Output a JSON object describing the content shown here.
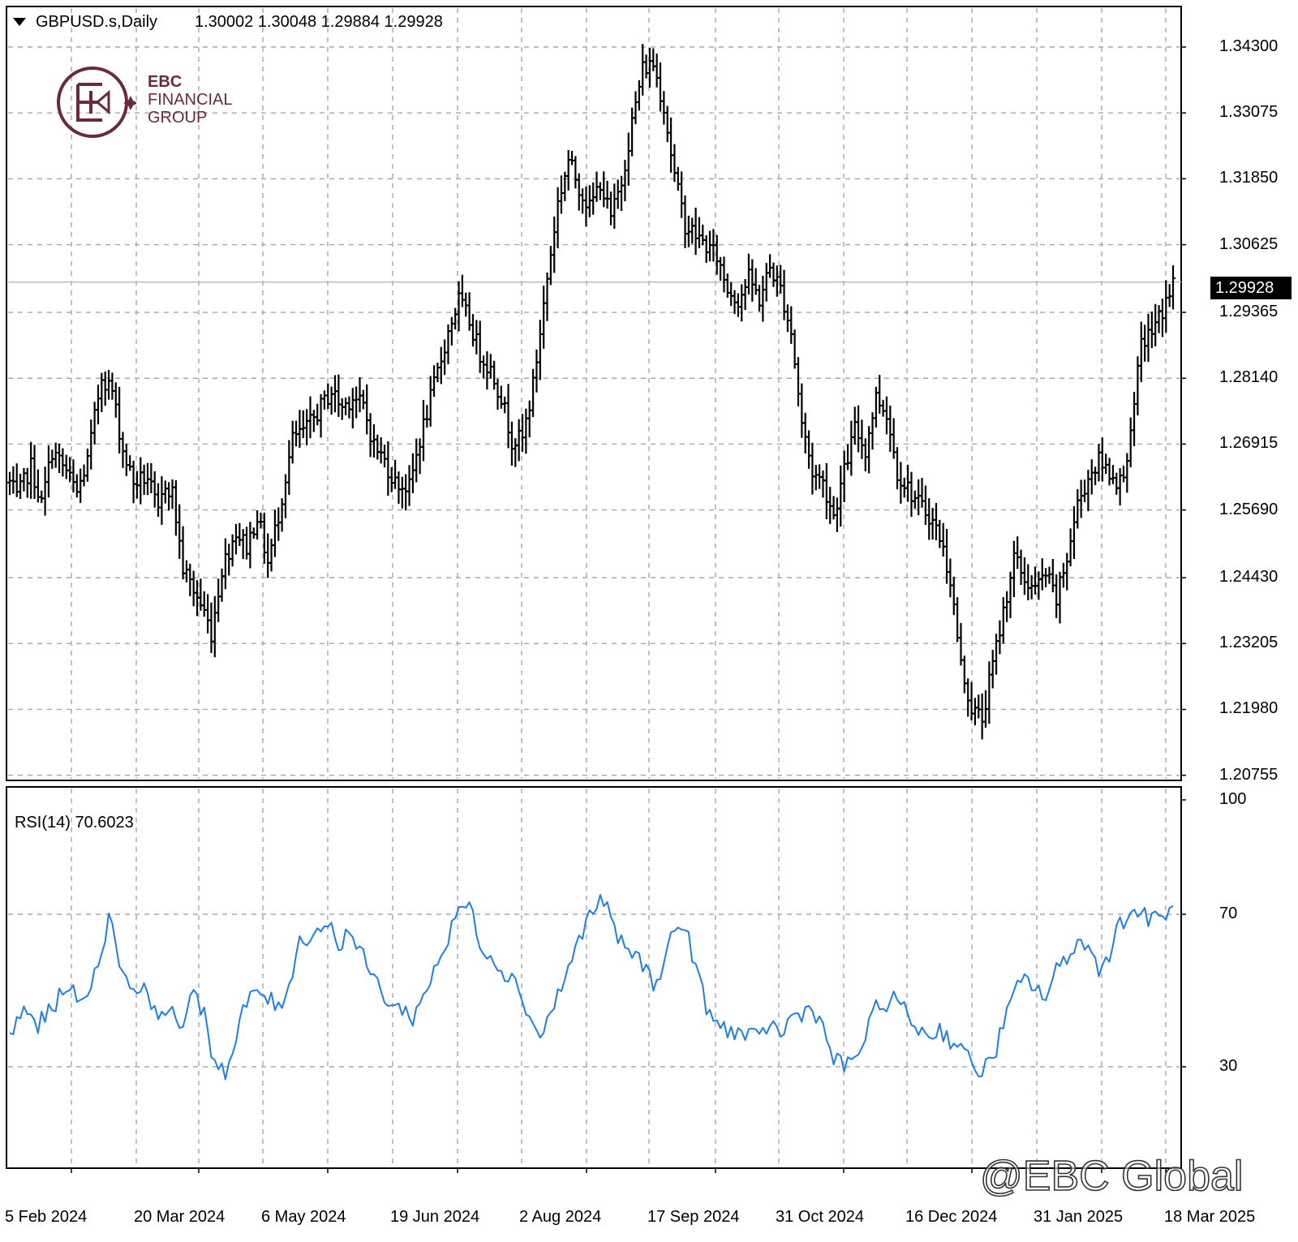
{
  "header": {
    "dropdown_icon": "triangle-down-icon",
    "symbol": "GBPUSD.s,Daily",
    "ohlc": "1.30002 1.30048 1.29884 1.29928"
  },
  "logo": {
    "line1": "EBC",
    "line2": "FINANCIAL",
    "line3": "GROUP",
    "color": "#6b2a3a"
  },
  "watermark": "@EBC Global",
  "chart_data": [
    {
      "type": "bar",
      "subtype": "ohlc",
      "title": "GBPUSD.s,Daily",
      "current_price": "1.29928",
      "y_ticks": [
        "1.34300",
        "1.33075",
        "1.31850",
        "1.30625",
        "1.29365",
        "1.28140",
        "1.26915",
        "1.25690",
        "1.24430",
        "1.23205",
        "1.21980",
        "1.20755"
      ],
      "ylim": [
        1.2075,
        1.343
      ],
      "x_ticks": [
        "5 Feb 2024",
        "20 Mar 2024",
        "6 May 2024",
        "19 Jun 2024",
        "2 Aug 2024",
        "17 Sep 2024",
        "31 Oct 2024",
        "16 Dec 2024",
        "31 Jan 2025",
        "18 Mar 2025"
      ],
      "grid": true,
      "bar_color": "#000000",
      "anchors": [
        [
          0,
          1.262
        ],
        [
          2,
          1.259
        ],
        [
          6,
          1.265
        ],
        [
          9,
          1.258
        ],
        [
          12,
          1.268
        ],
        [
          16,
          1.264
        ],
        [
          19,
          1.26
        ],
        [
          22,
          1.266
        ],
        [
          26,
          1.282
        ],
        [
          29,
          1.279
        ],
        [
          32,
          1.268
        ],
        [
          35,
          1.262
        ],
        [
          39,
          1.263
        ],
        [
          42,
          1.256
        ],
        [
          44,
          1.262
        ],
        [
          46,
          1.26
        ],
        [
          49,
          1.246
        ],
        [
          52,
          1.242
        ],
        [
          55,
          1.238
        ],
        [
          57,
          1.234
        ],
        [
          60,
          1.246
        ],
        [
          64,
          1.253
        ],
        [
          67,
          1.25
        ],
        [
          70,
          1.256
        ],
        [
          73,
          1.247
        ],
        [
          76,
          1.256
        ],
        [
          80,
          1.27
        ],
        [
          84,
          1.272
        ],
        [
          88,
          1.276
        ],
        [
          91,
          1.279
        ],
        [
          94,
          1.276
        ],
        [
          97,
          1.278
        ],
        [
          100,
          1.276
        ],
        [
          103,
          1.269
        ],
        [
          106,
          1.266
        ],
        [
          109,
          1.262
        ],
        [
          113,
          1.261
        ],
        [
          116,
          1.27
        ],
        [
          120,
          1.28
        ],
        [
          124,
          1.29
        ],
        [
          127,
          1.296
        ],
        [
          130,
          1.292
        ],
        [
          133,
          1.286
        ],
        [
          136,
          1.283
        ],
        [
          139,
          1.278
        ],
        [
          142,
          1.27
        ],
        [
          145,
          1.27
        ],
        [
          148,
          1.28
        ],
        [
          152,
          1.3
        ],
        [
          155,
          1.314
        ],
        [
          158,
          1.322
        ],
        [
          161,
          1.317
        ],
        [
          164,
          1.313
        ],
        [
          167,
          1.318
        ],
        [
          170,
          1.311
        ],
        [
          173,
          1.318
        ],
        [
          176,
          1.329
        ],
        [
          179,
          1.339
        ],
        [
          182,
          1.34
        ],
        [
          185,
          1.332
        ],
        [
          188,
          1.319
        ],
        [
          191,
          1.31
        ],
        [
          194,
          1.308
        ],
        [
          197,
          1.306
        ],
        [
          200,
          1.304
        ],
        [
          203,
          1.298
        ],
        [
          206,
          1.296
        ],
        [
          209,
          1.3
        ],
        [
          212,
          1.296
        ],
        [
          215,
          1.302
        ],
        [
          218,
          1.298
        ],
        [
          221,
          1.29
        ],
        [
          224,
          1.273
        ],
        [
          227,
          1.264
        ],
        [
          230,
          1.262
        ],
        [
          233,
          1.256
        ],
        [
          236,
          1.264
        ],
        [
          239,
          1.272
        ],
        [
          242,
          1.268
        ],
        [
          245,
          1.278
        ],
        [
          248,
          1.275
        ],
        [
          251,
          1.264
        ],
        [
          254,
          1.261
        ],
        [
          257,
          1.258
        ],
        [
          260,
          1.256
        ],
        [
          263,
          1.252
        ],
        [
          266,
          1.244
        ],
        [
          269,
          1.228
        ],
        [
          272,
          1.22
        ],
        [
          275,
          1.218
        ],
        [
          278,
          1.228
        ],
        [
          281,
          1.238
        ],
        [
          284,
          1.248
        ],
        [
          287,
          1.244
        ],
        [
          290,
          1.242
        ],
        [
          293,
          1.245
        ],
        [
          296,
          1.24
        ],
        [
          299,
          1.248
        ],
        [
          302,
          1.258
        ],
        [
          305,
          1.263
        ],
        [
          308,
          1.266
        ],
        [
          311,
          1.264
        ],
        [
          314,
          1.262
        ],
        [
          317,
          1.27
        ],
        [
          320,
          1.288
        ],
        [
          323,
          1.29
        ],
        [
          326,
          1.294
        ],
        [
          329,
          1.299
        ]
      ]
    },
    {
      "type": "line",
      "title": "RSI(14) 70.6023",
      "y_ticks": [
        "100",
        "70",
        "30"
      ],
      "ylim": [
        0,
        100
      ],
      "levels": [
        70,
        30
      ],
      "x_ticks": [
        "5 Feb 2024",
        "20 Mar 2024",
        "6 May 2024",
        "19 Jun 2024",
        "2 Aug 2024",
        "17 Sep 2024",
        "31 Oct 2024",
        "16 Dec 2024",
        "31 Jan 2025",
        "18 Mar 2025"
      ],
      "color": "#1e7fe0",
      "anchors": [
        [
          0,
          38
        ],
        [
          4,
          45
        ],
        [
          8,
          41
        ],
        [
          12,
          45
        ],
        [
          16,
          52
        ],
        [
          20,
          46
        ],
        [
          24,
          54
        ],
        [
          28,
          69
        ],
        [
          32,
          55
        ],
        [
          36,
          49
        ],
        [
          38,
          54
        ],
        [
          40,
          43
        ],
        [
          44,
          46
        ],
        [
          48,
          41
        ],
        [
          52,
          48
        ],
        [
          55,
          45
        ],
        [
          57,
          34
        ],
        [
          59,
          31
        ],
        [
          61,
          29
        ],
        [
          63,
          33
        ],
        [
          66,
          45
        ],
        [
          70,
          50
        ],
        [
          73,
          48
        ],
        [
          76,
          45
        ],
        [
          79,
          52
        ],
        [
          82,
          63
        ],
        [
          86,
          65
        ],
        [
          90,
          68
        ],
        [
          93,
          62
        ],
        [
          96,
          66
        ],
        [
          99,
          60
        ],
        [
          102,
          55
        ],
        [
          105,
          50
        ],
        [
          108,
          46
        ],
        [
          111,
          45
        ],
        [
          114,
          43
        ],
        [
          117,
          48
        ],
        [
          120,
          56
        ],
        [
          124,
          63
        ],
        [
          127,
          72
        ],
        [
          130,
          72
        ],
        [
          133,
          63
        ],
        [
          136,
          59
        ],
        [
          140,
          55
        ],
        [
          144,
          51
        ],
        [
          147,
          43
        ],
        [
          150,
          38
        ],
        [
          153,
          44
        ],
        [
          156,
          51
        ],
        [
          159,
          58
        ],
        [
          162,
          66
        ],
        [
          165,
          71
        ],
        [
          168,
          74
        ],
        [
          170,
          68
        ],
        [
          173,
          62
        ],
        [
          176,
          60
        ],
        [
          179,
          57
        ],
        [
          182,
          52
        ],
        [
          185,
          57
        ],
        [
          188,
          67
        ],
        [
          191,
          66
        ],
        [
          194,
          57
        ],
        [
          197,
          45
        ],
        [
          200,
          41
        ],
        [
          203,
          40
        ],
        [
          206,
          39
        ],
        [
          209,
          38
        ],
        [
          212,
          37
        ],
        [
          215,
          42
        ],
        [
          218,
          38
        ],
        [
          221,
          43
        ],
        [
          224,
          44
        ],
        [
          227,
          46
        ],
        [
          230,
          40
        ],
        [
          233,
          32
        ],
        [
          236,
          30
        ],
        [
          239,
          32
        ],
        [
          242,
          38
        ],
        [
          245,
          45
        ],
        [
          248,
          47
        ],
        [
          251,
          48
        ],
        [
          254,
          43
        ],
        [
          257,
          40
        ],
        [
          260,
          38
        ],
        [
          263,
          40
        ],
        [
          266,
          37
        ],
        [
          269,
          36
        ],
        [
          272,
          30
        ],
        [
          275,
          29
        ],
        [
          278,
          32
        ],
        [
          281,
          41
        ],
        [
          284,
          49
        ],
        [
          287,
          53
        ],
        [
          290,
          51
        ],
        [
          293,
          48
        ],
        [
          296,
          55
        ],
        [
          299,
          59
        ],
        [
          302,
          63
        ],
        [
          305,
          61
        ],
        [
          308,
          56
        ],
        [
          311,
          60
        ],
        [
          314,
          68
        ],
        [
          317,
          70
        ],
        [
          320,
          71
        ],
        [
          323,
          68
        ],
        [
          326,
          70
        ],
        [
          329,
          71
        ]
      ]
    }
  ]
}
